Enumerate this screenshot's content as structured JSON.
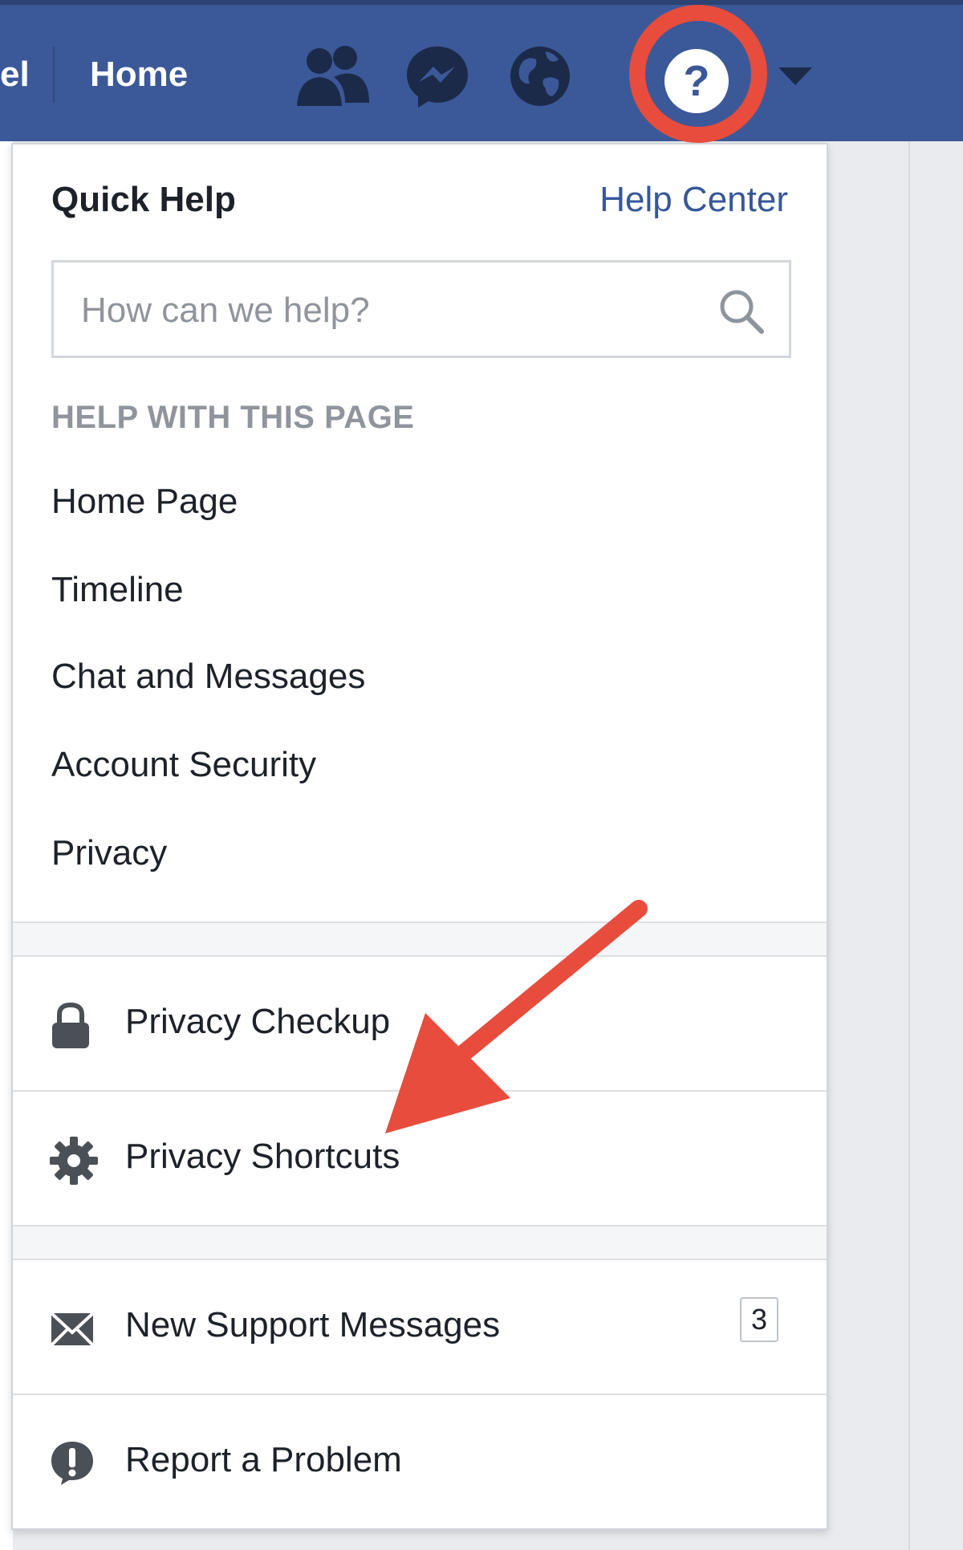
{
  "topbar": {
    "cut_text": "el",
    "home_label": "Home",
    "icons": [
      "friends-icon",
      "messenger-icon",
      "globe-icon",
      "help-icon",
      "caret-down-icon"
    ]
  },
  "quick_help": {
    "title": "Quick Help",
    "help_center_link": "Help Center",
    "search_placeholder": "How can we help?",
    "section_heading": "HELP WITH THIS PAGE",
    "topics": [
      "Home Page",
      "Timeline",
      "Chat and Messages",
      "Account Security",
      "Privacy"
    ]
  },
  "actions": {
    "privacy_checkup": "Privacy Checkup",
    "privacy_shortcuts": "Privacy Shortcuts",
    "support_messages": "New Support Messages",
    "support_count": "3",
    "report_problem": "Report a Problem"
  },
  "colors": {
    "topbar": "#3b5998",
    "link": "#365899",
    "annotation": "#e74c3c"
  }
}
